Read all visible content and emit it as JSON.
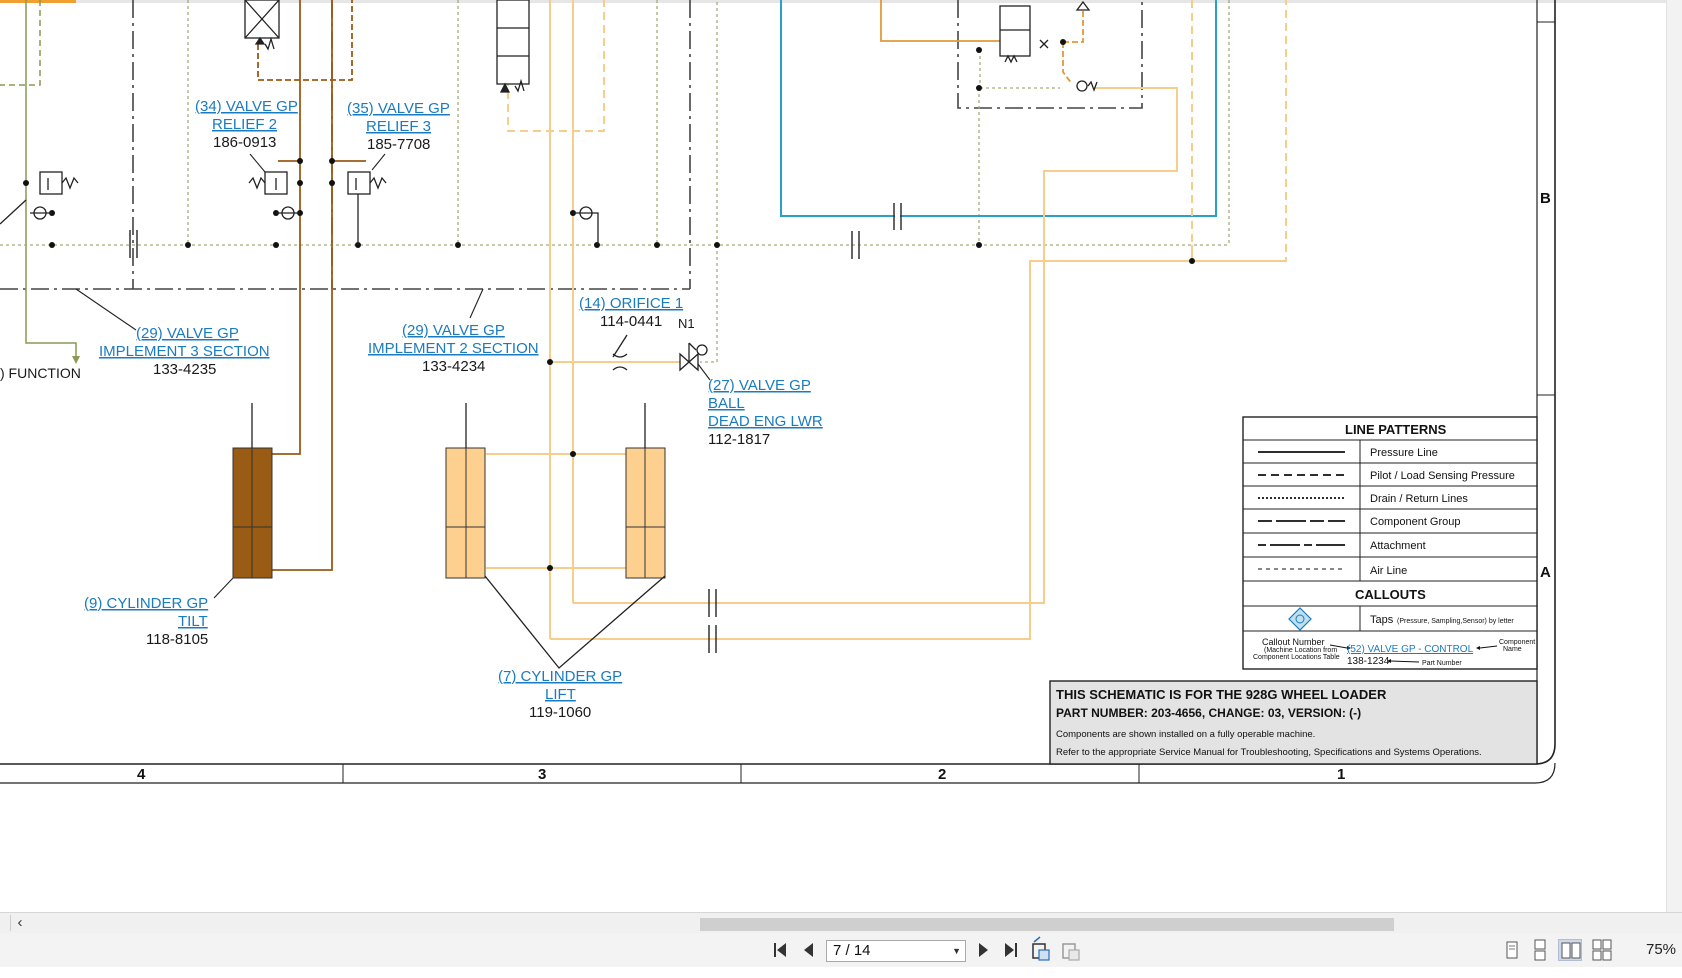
{
  "schematic": {
    "labels": {
      "valve34": {
        "line1": "(34) VALVE GP",
        "line2": "RELIEF 2",
        "part": "186-0913"
      },
      "valve35": {
        "line1": "(35) VALVE GP",
        "line2": "RELIEF 3",
        "part": "185-7708"
      },
      "valve29a": {
        "line1": "(29) VALVE GP",
        "line2": "IMPLEMENT 3 SECTION",
        "part": "133-4235"
      },
      "valve29b": {
        "line1": "(29) VALVE GP",
        "line2": "IMPLEMENT 2 SECTION",
        "part": "133-4234"
      },
      "orifice14": {
        "line1": "(14) ORIFICE 1",
        "part": "114-0441"
      },
      "valve27": {
        "line1": "(27) VALVE GP",
        "line2": "BALL",
        "line3": "DEAD ENG LWR",
        "part": "112-1817"
      },
      "cyl9": {
        "line1": "(9) CYLINDER GP",
        "line2": "TILT",
        "part": "118-8105"
      },
      "cyl7": {
        "line1": "(7) CYLINDER GP",
        "line2": "LIFT",
        "part": "119-1060"
      },
      "n1": "N1",
      "function_text": ") FUNCTION"
    },
    "zones_columns": [
      "4",
      "3",
      "2",
      "1"
    ],
    "zones_rows": [
      "B",
      "A"
    ],
    "legend": {
      "title": "LINE PATTERNS",
      "rows": [
        "Pressure Line",
        "Pilot / Load Sensing Pressure",
        "Drain / Return Lines",
        "Component Group",
        "Attachment",
        "Air Line"
      ],
      "callouts_title": "CALLOUTS",
      "taps_label": "Taps",
      "taps_note": "(Pressure, Sampling,Sensor) by letter",
      "callout_number": "Callout Number",
      "callout_loc1": "(Machine Location from",
      "callout_loc2": "Component Locations Table",
      "sample_link": "(52) VALVE GP - CONTROL",
      "sample_part": "138-1234",
      "component_label1": "Component",
      "component_label2": "Name",
      "part_number_label": "Part Number"
    },
    "titleblock": {
      "line1": "THIS SCHEMATIC IS FOR THE 928G WHEEL LOADER",
      "line2": "PART NUMBER: 203-4656, CHANGE: 03, VERSION: (-)",
      "line3": "Components are shown installed on a fully operable machine.",
      "line4": "Refer to the appropriate Service Manual for Troubleshooting, Specifications and Systems Operations."
    },
    "colors": {
      "brown": "#9a5b15",
      "tan": "#f6cd8a",
      "teal": "#2a9fc9",
      "olive": "#8a9a55",
      "orange": "#e09a3a",
      "link": "#1a7bbf"
    }
  },
  "toolbar": {
    "page_value": "7 / 14",
    "zoom": "75%"
  }
}
